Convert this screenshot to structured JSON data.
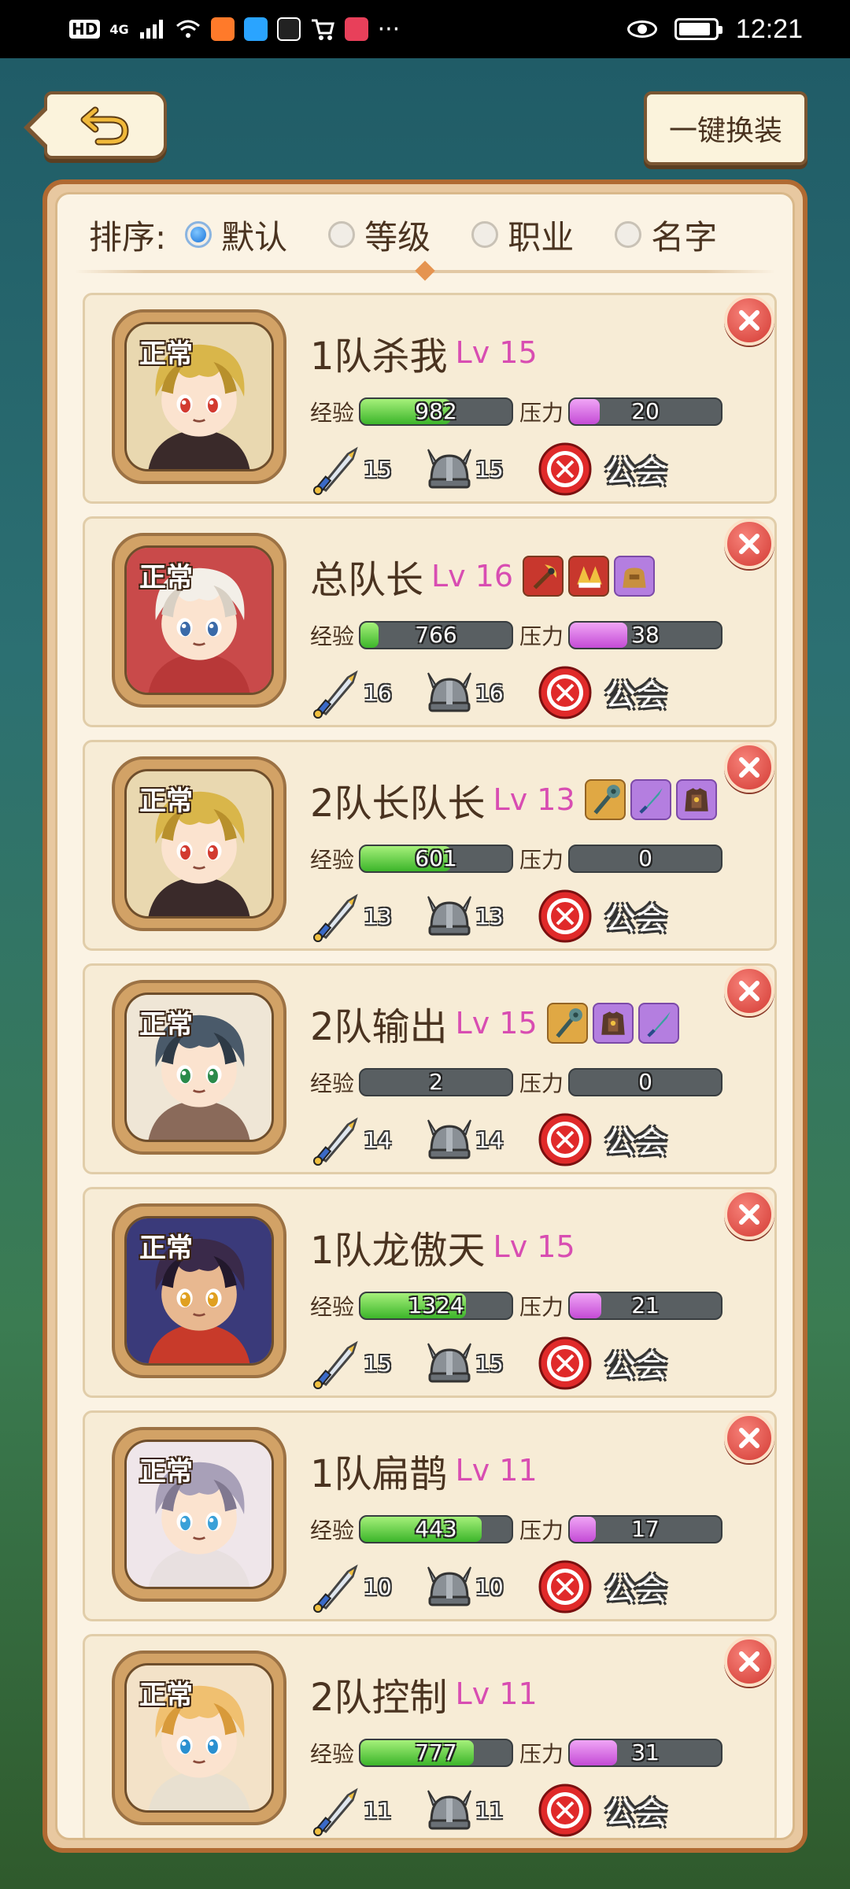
{
  "status_bar": {
    "network_badge": "HD",
    "signal_label": "4G",
    "time": "12:21"
  },
  "header": {
    "back_icon": "undo-arrow-icon",
    "equip_button_label": "一键换装"
  },
  "sort": {
    "label": "排序:",
    "options": [
      {
        "label": "默认",
        "selected": true
      },
      {
        "label": "等级",
        "selected": false
      },
      {
        "label": "职业",
        "selected": false
      },
      {
        "label": "名字",
        "selected": false
      }
    ]
  },
  "labels": {
    "exp": "经验",
    "pressure": "压力",
    "guild": "公会",
    "status": "正常"
  },
  "colors": {
    "level": "#d84db2",
    "exp_bar": "#3cb52a",
    "pressure_bar": "#c44bd6",
    "panel_border": "#b06a32"
  },
  "members": [
    {
      "status": "正常",
      "name": "1队杀我",
      "level": "Lv 15",
      "exp": "982",
      "exp_fill": 0.6,
      "pressure": "20",
      "pressure_fill": 0.2,
      "attack": "15",
      "defense": "15",
      "guild": "公会",
      "equipment": [],
      "portrait": "blond-swordsman"
    },
    {
      "status": "正常",
      "name": "总队长",
      "level": "Lv 16",
      "exp": "766",
      "exp_fill": 0.12,
      "pressure": "38",
      "pressure_fill": 0.38,
      "attack": "16",
      "defense": "16",
      "guild": "公会",
      "equipment": [
        "axe-icon",
        "crest-icon",
        "bag-icon"
      ],
      "portrait": "red-hood-nun"
    },
    {
      "status": "正常",
      "name": "2队长队长",
      "level": "Lv 13",
      "exp": "601",
      "exp_fill": 0.6,
      "pressure": "0",
      "pressure_fill": 0.0,
      "attack": "13",
      "defense": "13",
      "guild": "公会",
      "equipment": [
        "mace-icon",
        "dagger-icon",
        "armor-icon"
      ],
      "portrait": "blond-swordsman"
    },
    {
      "status": "正常",
      "name": "2队输出",
      "level": "Lv 15",
      "exp": "2",
      "exp_fill": 0.0,
      "pressure": "0",
      "pressure_fill": 0.0,
      "attack": "14",
      "defense": "14",
      "guild": "公会",
      "equipment": [
        "mace-icon",
        "armor-icon",
        "dagger-icon"
      ],
      "portrait": "gunner-girl"
    },
    {
      "status": "正常",
      "name": "1队龙傲天",
      "level": "Lv 15",
      "exp": "1324",
      "exp_fill": 0.7,
      "pressure": "21",
      "pressure_fill": 0.21,
      "attack": "15",
      "defense": "15",
      "guild": "公会",
      "equipment": [],
      "portrait": "dark-warrior"
    },
    {
      "status": "正常",
      "name": "1队扁鹊",
      "level": "Lv 11",
      "exp": "443",
      "exp_fill": 0.8,
      "pressure": "17",
      "pressure_fill": 0.17,
      "attack": "10",
      "defense": "10",
      "guild": "公会",
      "equipment": [],
      "portrait": "silver-healer"
    },
    {
      "status": "正常",
      "name": "2队控制",
      "level": "Lv 11",
      "exp": "777",
      "exp_fill": 0.75,
      "pressure": "31",
      "pressure_fill": 0.31,
      "attack": "11",
      "defense": "11",
      "guild": "公会",
      "equipment": [],
      "portrait": "orange-hair-mage"
    }
  ]
}
